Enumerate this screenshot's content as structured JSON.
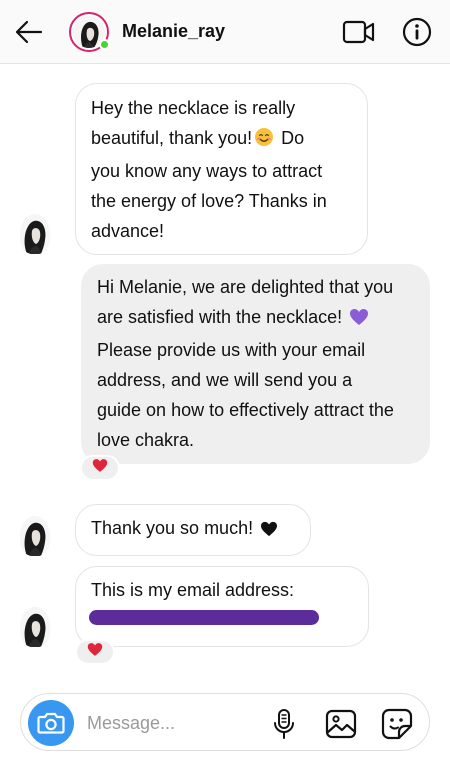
{
  "header": {
    "username": "Melanie_ray",
    "online": true
  },
  "messages": [
    {
      "sender": "Melanie_ray",
      "direction": "incoming",
      "lines": [
        "Hey the necklace is really",
        "beautiful, thank you!",
        "Do",
        "you know any ways to attract",
        "the energy of love? Thanks in",
        "advance!"
      ],
      "emoji": "smiling-face-emoji"
    },
    {
      "sender": "me",
      "direction": "outgoing",
      "lines": [
        "Hi Melanie, we are delighted that you",
        "are satisfied with the necklace!",
        "Please provide us with your email",
        "address, and we will send you a",
        "guide on how to effectively attract the",
        "love chakra."
      ],
      "emoji": "purple-heart-emoji",
      "reaction": "red-heart-emoji"
    },
    {
      "sender": "Melanie_ray",
      "direction": "incoming",
      "text": "Thank you so much!",
      "emoji": "black-heart-emoji"
    },
    {
      "sender": "Melanie_ray",
      "direction": "incoming",
      "text": "This is my email address:",
      "redacted": true,
      "reaction": "red-heart-emoji"
    }
  ],
  "composer": {
    "placeholder": "Message..."
  },
  "colors": {
    "accent_blue": "#3897f0",
    "story_ring": "#d6246e",
    "online_green": "#4cd137",
    "redaction_purple": "#5c2d9a",
    "outgoing_bubble": "#efefef",
    "heart_red": "#e0243a"
  }
}
